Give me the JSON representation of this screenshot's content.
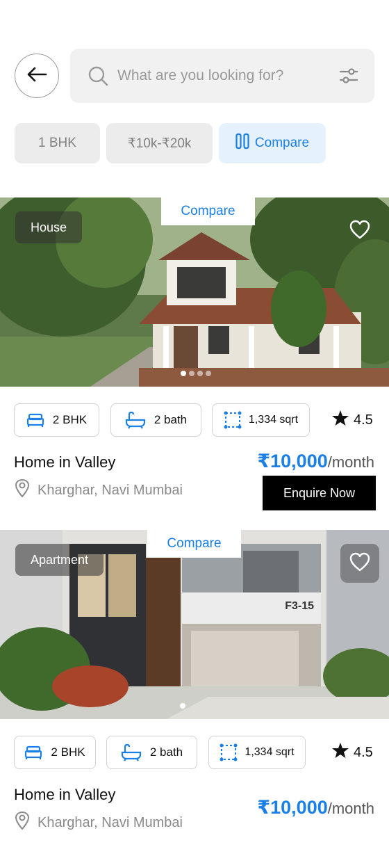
{
  "header": {
    "search_placeholder": "What are you looking for?",
    "back_icon": "arrow-left-icon",
    "search_icon": "search-icon",
    "filter_icon": "sliders-icon"
  },
  "chips": [
    {
      "label": "1 BHK"
    },
    {
      "label": "₹10k-₹20k"
    },
    {
      "label": "Compare",
      "icon": "compare-columns-icon"
    }
  ],
  "colors": {
    "accent": "#1a7fe6",
    "chip_bg": "#ececec",
    "compare_bg": "#e5f2fd"
  },
  "listings": [
    {
      "type": "House",
      "compare_label": "Compare",
      "beds": "2 BHK",
      "baths": "2 bath",
      "area": "1,334 sqrt",
      "rating": "4.5",
      "title": "Home in Valley",
      "location": "Kharghar, Navi Mumbai",
      "price": "₹10,000",
      "period": "/month",
      "cta": "Enquire Now"
    },
    {
      "type": "Apartment",
      "compare_label": "Compare",
      "beds": "2 BHK",
      "baths": "2 bath",
      "area": "1,334 sqrt",
      "rating": "4.5",
      "title": "Home in Valley",
      "location": "Kharghar, Navi Mumbai",
      "price": "₹10,000",
      "period": "/month",
      "sign": "F3-15"
    }
  ]
}
